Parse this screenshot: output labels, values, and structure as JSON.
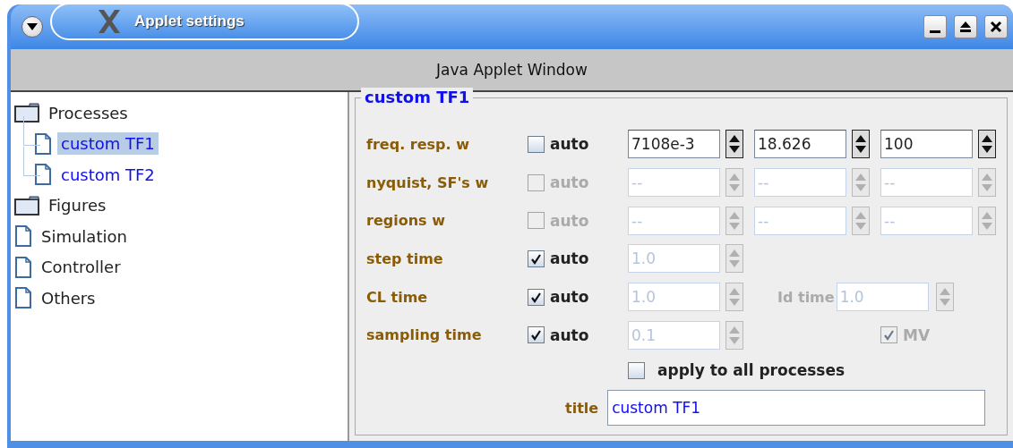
{
  "window": {
    "title": "Applet settings"
  },
  "applet_banner": "Java Applet Window",
  "tree": [
    {
      "label": "Processes",
      "kind": "folder",
      "children": [
        {
          "label": "custom TF1",
          "selected": true
        },
        {
          "label": "custom TF2",
          "selected": false
        }
      ]
    },
    {
      "label": "Figures",
      "kind": "folder"
    },
    {
      "label": "Simulation",
      "kind": "file"
    },
    {
      "label": "Controller",
      "kind": "file"
    },
    {
      "label": "Others",
      "kind": "file"
    }
  ],
  "panel": {
    "title": "custom TF1",
    "rows": [
      {
        "label": "freq. resp. w",
        "auto": {
          "label": "auto",
          "checked": false,
          "disabled": false
        },
        "fields": [
          {
            "value": "7108e-3",
            "disabled": false
          },
          {
            "value": "18.626",
            "disabled": false
          },
          {
            "value": "100",
            "disabled": false
          }
        ]
      },
      {
        "label": "nyquist, SF's w",
        "auto": {
          "label": "auto",
          "checked": false,
          "disabled": true
        },
        "fields": [
          {
            "value": "--",
            "disabled": true
          },
          {
            "value": "--",
            "disabled": true
          },
          {
            "value": "--",
            "disabled": true
          }
        ]
      },
      {
        "label": "regions w",
        "auto": {
          "label": "auto",
          "checked": false,
          "disabled": true
        },
        "fields": [
          {
            "value": "--",
            "disabled": true
          },
          {
            "value": "--",
            "disabled": true
          },
          {
            "value": "--",
            "disabled": true
          }
        ]
      },
      {
        "label": "step time",
        "auto": {
          "label": "auto",
          "checked": true,
          "disabled": false
        },
        "fields": [
          {
            "value": "1.0",
            "disabled": true
          }
        ]
      },
      {
        "label": "CL time",
        "auto": {
          "label": "auto",
          "checked": true,
          "disabled": false
        },
        "fields": [
          {
            "value": "1.0",
            "disabled": true
          }
        ],
        "extra": {
          "kind": "field",
          "label": "Id time",
          "value": "1.0",
          "disabled": true
        }
      },
      {
        "label": "sampling time",
        "auto": {
          "label": "auto",
          "checked": true,
          "disabled": false
        },
        "fields": [
          {
            "value": "0.1",
            "disabled": true
          }
        ],
        "extra": {
          "kind": "checkbox",
          "label": "MV",
          "checked": true,
          "disabled": true
        }
      }
    ],
    "apply": {
      "label": "apply to all processes",
      "checked": false
    },
    "title_field": {
      "label": "title",
      "value": "custom TF1"
    }
  }
}
